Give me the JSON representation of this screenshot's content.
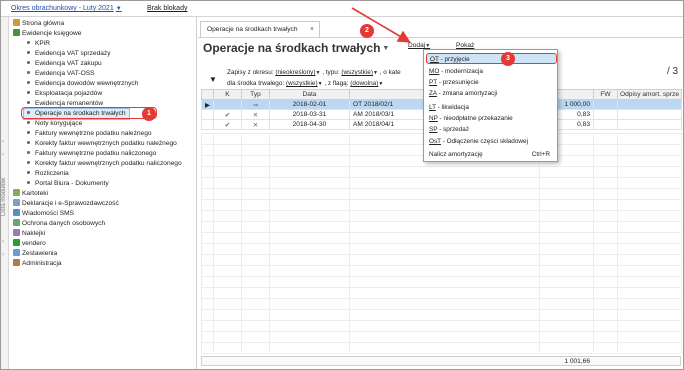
{
  "topbar": {
    "period_label": "Okres obrachunkowy - Luty 2021",
    "no_blocks_label": "Brak blokady"
  },
  "strip": {
    "label": "Lista modułów"
  },
  "tree": {
    "items": [
      {
        "label": "Strona główna"
      },
      {
        "label": "Ewidencje księgowe"
      },
      {
        "label": "KPiR"
      },
      {
        "label": "Ewidencja VAT sprzedaży"
      },
      {
        "label": "Ewidencja VAT zakupu"
      },
      {
        "label": "Ewidencja VAT-OSS"
      },
      {
        "label": "Ewidencja dowodów wewnętrznych"
      },
      {
        "label": "Eksploatacja pojazdów"
      },
      {
        "label": "Ewidencja remanentów"
      },
      {
        "label": "Operacje na środkach trwałych"
      },
      {
        "label": "Noty korygujące"
      },
      {
        "label": "Faktury wewnętrzne podatku należnego"
      },
      {
        "label": "Korekty faktur wewnętrznych podatku należnego"
      },
      {
        "label": "Faktury wewnętrzne podatku naliczonego"
      },
      {
        "label": "Korekty faktur wewnętrznych podatku naliczonego"
      },
      {
        "label": "Rozliczenia"
      },
      {
        "label": "Portal Biura - Dokumenty"
      },
      {
        "label": "Kartoteki"
      },
      {
        "label": "Deklaracje i e-Sprawozdawczość"
      },
      {
        "label": "Wiadomości SMS"
      },
      {
        "label": "Ochrona danych osobowych"
      },
      {
        "label": "Naklejki"
      },
      {
        "label": "vendero"
      },
      {
        "label": "Zestawienia"
      },
      {
        "label": "Administracja"
      }
    ]
  },
  "callouts": {
    "c1": "1",
    "c2": "2",
    "c3": "3"
  },
  "tab": {
    "label": "Operacje na środkach trwałych",
    "close": "×"
  },
  "page": {
    "title": "Operacje na środkach trwałych",
    "add_label": "Dodaj",
    "show_label": "Pokaż",
    "page_count": "/ 3"
  },
  "filters": {
    "line1_label": "Zapisy z okresu:",
    "period_value": "(nieokreślony)",
    "type_label": ", typu:",
    "type_value": "(wszystkie)",
    "category_label": ", o kate",
    "line2_label": "dla środka trwałego:",
    "asset_value": "(wszystkie)",
    "flag_label": ", z flagą:",
    "flag_value": "(dowolna)"
  },
  "grid": {
    "columns": [
      "",
      "K",
      "Typ",
      "Data",
      "N",
      "",
      "FW",
      "Odpisy amort. sprze"
    ],
    "rows": [
      {
        "marker": "▶",
        "k": "",
        "typ": "⇒",
        "date": "2018-02-01",
        "number": "OT 2018/02/1",
        "amount": "1 000,00",
        "fw": "",
        "odpisy": ""
      },
      {
        "marker": "",
        "k": "✔",
        "typ": "✕",
        "date": "2018-03-31",
        "number": "AM 2018/03/1",
        "amount": "0,83",
        "fw": "",
        "odpisy": ""
      },
      {
        "marker": "",
        "k": "✔",
        "typ": "✕",
        "date": "2018-04-30",
        "number": "AM 2018/04/1",
        "amount": "0,83",
        "fw": "",
        "odpisy": ""
      }
    ],
    "total": "1 001,66"
  },
  "dropdown": {
    "items": [
      {
        "key": "OT",
        "rest": " - przyjęcie"
      },
      {
        "key": "MO",
        "rest": " - modernizacja"
      },
      {
        "key": "PT",
        "rest": " - przesunięcie"
      },
      {
        "key": "ZA",
        "rest": " - zmiana amortyzacji"
      },
      {
        "key": "LT",
        "rest": " - likwidacja"
      },
      {
        "key": "NP",
        "rest": " - nieodpłatne przekazanie"
      },
      {
        "key": "SP",
        "rest": " - sprzedaż"
      },
      {
        "key": "OsT",
        "rest": " - Odłączenie części składowej"
      },
      {
        "key": "",
        "rest": "Nalicz amortyzację"
      }
    ],
    "shortcut": "Ctrl+R"
  },
  "colors": {
    "accent": "#1f4fb0",
    "callout": "#e53935",
    "selection": "#bcd7f1"
  }
}
